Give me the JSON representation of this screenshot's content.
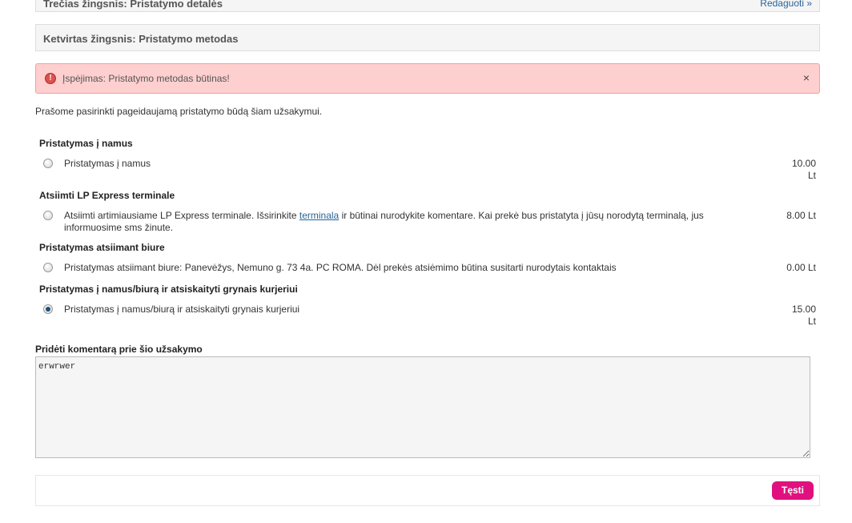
{
  "previous_step": {
    "title": "Trečias žingsnis: Pristatymo detalės",
    "edit_label": "Redaguoti »"
  },
  "current_step": {
    "title": "Ketvirtas žingsnis: Pristatymo metodas"
  },
  "alert": {
    "message": "Įspėjimas: Pristatymo metodas būtinas!",
    "close_label": "×",
    "icon_glyph": "!",
    "icon": "warning-icon"
  },
  "intro_text": "Prašome pasirinkti pageidaujamą pristatymo būdą šiam užsakymui.",
  "shipping_groups": [
    {
      "title": "Pristatymas į namus",
      "option": {
        "label": "Pristatymas į namus",
        "price": "10.00",
        "currency": "Lt",
        "selected": false
      }
    },
    {
      "title": "Atsiimti LP Express terminale",
      "option": {
        "label_before": "Atsiimti artimiausiame LP Express terminale. Išsirinkite ",
        "link_text": "terminala",
        "label_after": " ir būtinai nurodykite komentare. Kai prekė bus pristatyta į jūsų norodytą terminalą, jus informuosime sms žinute.",
        "price": "8.00 Lt",
        "selected": false
      }
    },
    {
      "title": "Pristatymas atsiimant biure",
      "option": {
        "label": "Pristatymas atsiimant biure: Panevėžys, Nemuno g. 73 4a. PC ROMA. Dėl prekės atsiėmimo būtina susitarti nurodytais kontaktais",
        "price": "0.00 Lt",
        "selected": false
      }
    },
    {
      "title": "Pristatymas į namus/biurą ir atsiskaityti grynais kurjeriui",
      "option": {
        "label": "Pristatymas į namus/biurą ir atsiskaityti grynais kurjeriui",
        "price": "15.00",
        "currency": "Lt",
        "selected": true
      }
    }
  ],
  "comment": {
    "label": "Pridėti komentarą prie šio užsakymo",
    "value": "erwrwer"
  },
  "continue_button": {
    "label": "Tęsti"
  },
  "colors": {
    "accent": "#e0117f",
    "alert_bg": "#fecfcf",
    "link": "#2a6496"
  }
}
